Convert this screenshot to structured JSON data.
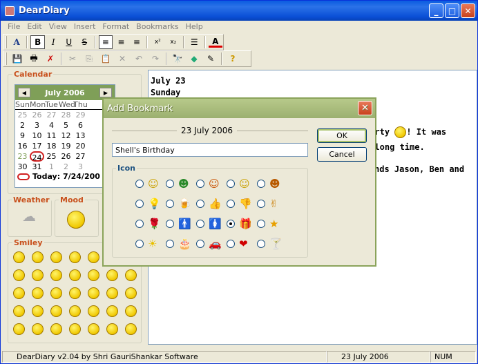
{
  "window": {
    "title": "DearDiary"
  },
  "menu": [
    "File",
    "Edit",
    "View",
    "Insert",
    "Format",
    "Bookmarks",
    "Help"
  ],
  "calendar": {
    "label": "Calendar",
    "month": "July 2006",
    "weekdays": [
      "Sun",
      "Mon",
      "Tue",
      "Wed",
      "Thu"
    ],
    "weeks": [
      [
        "25",
        "26",
        "27",
        "28",
        "29"
      ],
      [
        "2",
        "3",
        "4",
        "5",
        "6"
      ],
      [
        "9",
        "10",
        "11",
        "12",
        "13"
      ],
      [
        "16",
        "17",
        "18",
        "19",
        "20"
      ],
      [
        "23",
        "24",
        "25",
        "26",
        "27"
      ],
      [
        "30",
        "31",
        "1",
        "2",
        "3"
      ]
    ],
    "today_text": "Today: 7/24/200"
  },
  "panels": {
    "weather_label": "Weather",
    "mood_label": "Mood",
    "smiley_label": "Smiley"
  },
  "editor": {
    "lines": [
      "July 23",
      "Sunday",
      "",
      "",
      "party",
      "! It was",
      "a long time.",
      "",
      "nds Jason, Ben and"
    ]
  },
  "dialog": {
    "title": "Add Bookmark",
    "date": "23 July 2006",
    "name_value": "Shell's Birthday",
    "ok_label": "OK",
    "cancel_label": "Cancel",
    "icon_group_label": "Icon",
    "icons": [
      [
        "smile-icon",
        "grin-icon",
        "cool-icon",
        "wink-icon",
        "tongue-icon"
      ],
      [
        "bulb-icon",
        "beer-icon",
        "thumbs-up-icon",
        "thumbs-down-icon",
        "peace-icon"
      ],
      [
        "rose-icon",
        "man-icon",
        "woman-icon",
        "gift-icon",
        "star-icon"
      ],
      [
        "sun-icon",
        "cake-icon",
        "car-icon",
        "heart-icon",
        "cocktail-icon"
      ]
    ],
    "selected_icon": "gift-icon"
  },
  "status": {
    "app_text": "DearDiary v2.04 by Shri GauriShankar Software",
    "date": "23 July 2006",
    "num": "NUM"
  }
}
